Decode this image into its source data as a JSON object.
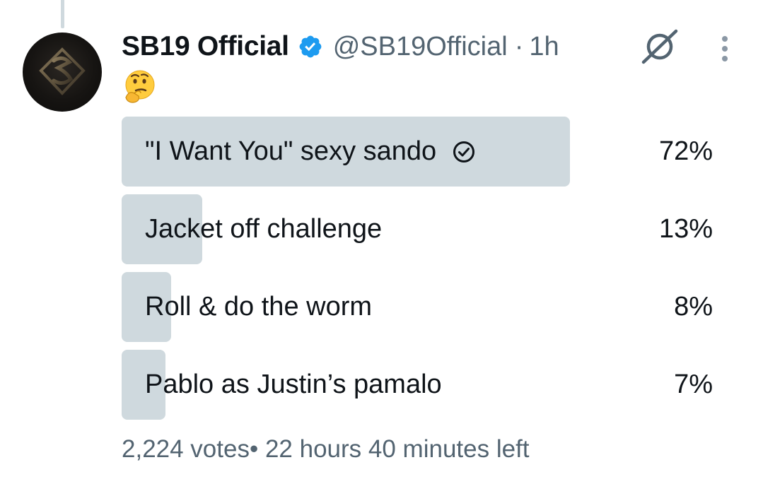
{
  "tweet": {
    "display_name": "SB19 Official",
    "handle": "@SB19Official",
    "separator": "·",
    "time": "1h",
    "emoji": "🤔",
    "avatar_icon": "sb19-logo-icon",
    "verified_icon": "verified-badge-icon",
    "actions_icons": [
      "grok-icon",
      "more-options-icon"
    ]
  },
  "poll": {
    "options": [
      {
        "label": "\"I Want You\" sexy sando",
        "percent": "72%",
        "share": 0.72,
        "voted": true
      },
      {
        "label": "Jacket off challenge",
        "percent": "13%",
        "share": 0.13,
        "voted": false
      },
      {
        "label": "Roll & do the worm",
        "percent": "8%",
        "share": 0.08,
        "voted": false
      },
      {
        "label": "Pablo as Justin’s pamalo",
        "percent": "7%",
        "share": 0.07,
        "voted": false
      }
    ],
    "votes": "2,224 votes",
    "votes_separator": "•",
    "time_left": "22 hours 40 minutes left"
  },
  "colors": {
    "bar": "#cfd9de",
    "secondary_text": "#536471",
    "verified": "#1d9bf0"
  }
}
